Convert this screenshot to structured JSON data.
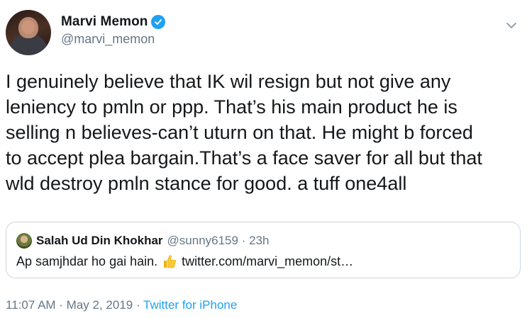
{
  "tweet": {
    "author": {
      "display_name": "Marvi Memon",
      "handle": "@marvi_memon",
      "verified": true
    },
    "text": "I genuinely believe that IK wil resign but not give any\nleniency to pmln or ppp. That’s his main product he is\nselling n believes-can’t uturn on that. He might b forced\nto accept plea bargain.That’s a face saver for all but that\nwld destroy pmln stance for good. a tuff one4all",
    "quoted_tweet": {
      "display_name": "Salah Ud Din Khokhar",
      "handle_time": "@sunny6159 · 23h",
      "text": "Ap samjhdar ho gai hain.",
      "emoji_icon": "thumbs-up-icon",
      "link": "twitter.com/marvi_memon/st…"
    },
    "meta": {
      "timestamp": "11:07 AM · May 2, 2019 · ",
      "source": "Twitter for iPhone"
    }
  },
  "colors": {
    "primary_text": "#14171a",
    "secondary_text": "#657786",
    "accent": "#1da1f2",
    "border": "#ccd6dd"
  }
}
